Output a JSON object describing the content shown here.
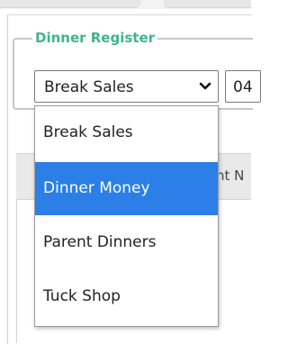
{
  "register": {
    "legend": "Dinner Register",
    "selected_value": "Break Sales",
    "date_value": "04"
  },
  "table": {
    "header_partial": "nt N"
  },
  "dropdown": {
    "options": [
      {
        "label": "Break Sales"
      },
      {
        "label": "Dinner Money"
      },
      {
        "label": "Parent Dinners"
      },
      {
        "label": "Tuck Shop"
      }
    ],
    "highlighted_index": 1
  },
  "colors": {
    "legend": "#3db58d",
    "highlight": "#2b7fe6"
  },
  "icons": {
    "select_arrow": "chevron-down-icon"
  }
}
